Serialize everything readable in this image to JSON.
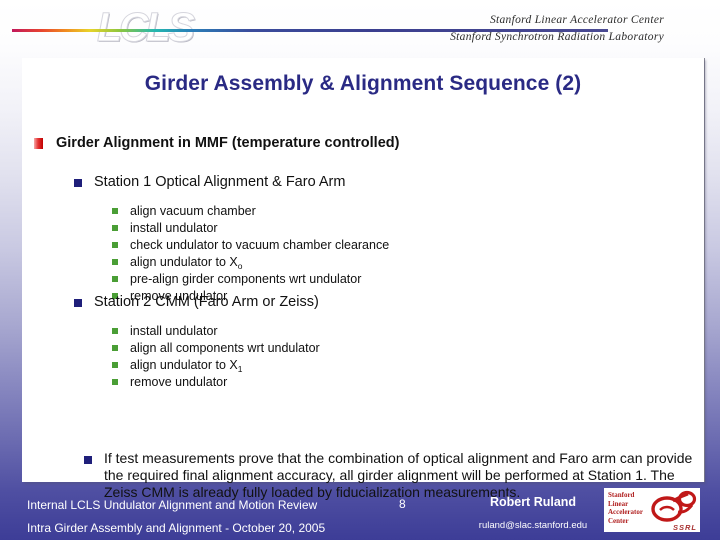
{
  "header": {
    "logo_text": "LCLS",
    "org_line1": "Stanford Linear Accelerator Center",
    "org_line2": "Stanford Synchrotron Radiation Laboratory"
  },
  "slide": {
    "title": "Girder Assembly & Alignment Sequence (2)",
    "level1": {
      "text": "Girder Alignment in MMF (temperature controlled)"
    },
    "station1": {
      "heading": "Station 1  Optical Alignment & Faro Arm",
      "items": [
        {
          "text": "align vacuum chamber",
          "sub": ""
        },
        {
          "text": "install undulator",
          "sub": ""
        },
        {
          "text": "check undulator to vacuum chamber clearance",
          "sub": ""
        },
        {
          "text": "align undulator to X",
          "sub": "o"
        },
        {
          "text": "pre-align girder components wrt undulator",
          "sub": ""
        },
        {
          "text": "remove undulator",
          "sub": ""
        }
      ]
    },
    "station2": {
      "heading": "Station 2  CMM  (Faro Arm or Zeiss)",
      "items": [
        {
          "text": "install undulator",
          "sub": ""
        },
        {
          "text": "align all components wrt undulator",
          "sub": ""
        },
        {
          "text": "align undulator to X",
          "sub": "1"
        },
        {
          "text": "remove undulator",
          "sub": ""
        }
      ]
    },
    "conclusion": "If test measurements prove that the combination of optical alignment and Faro arm can provide the required final alignment accuracy, all girder alignment will be performed at Station 1. The Zeiss CMM is already fully loaded by fiducialization measurements."
  },
  "footer": {
    "line1": "Internal LCLS Undulator Alignment and Motion Review",
    "line2": "Intra Girder Assembly and Alignment  -   October 20, 2005",
    "page_number": "8",
    "author": "Robert Ruland",
    "email": "ruland@slac.stanford.edu",
    "badge": {
      "l1": "Stanford",
      "l2": "Linear",
      "l3": "Accelerator",
      "l4": "Center",
      "ssrl": "SSRL"
    }
  },
  "colors": {
    "title_navy": "#2a2a84",
    "bullet_red": "#e53434",
    "bullet_navy": "#1f1f7a",
    "bullet_green": "#4a9e35",
    "footer_bg": "#3d3d97"
  }
}
